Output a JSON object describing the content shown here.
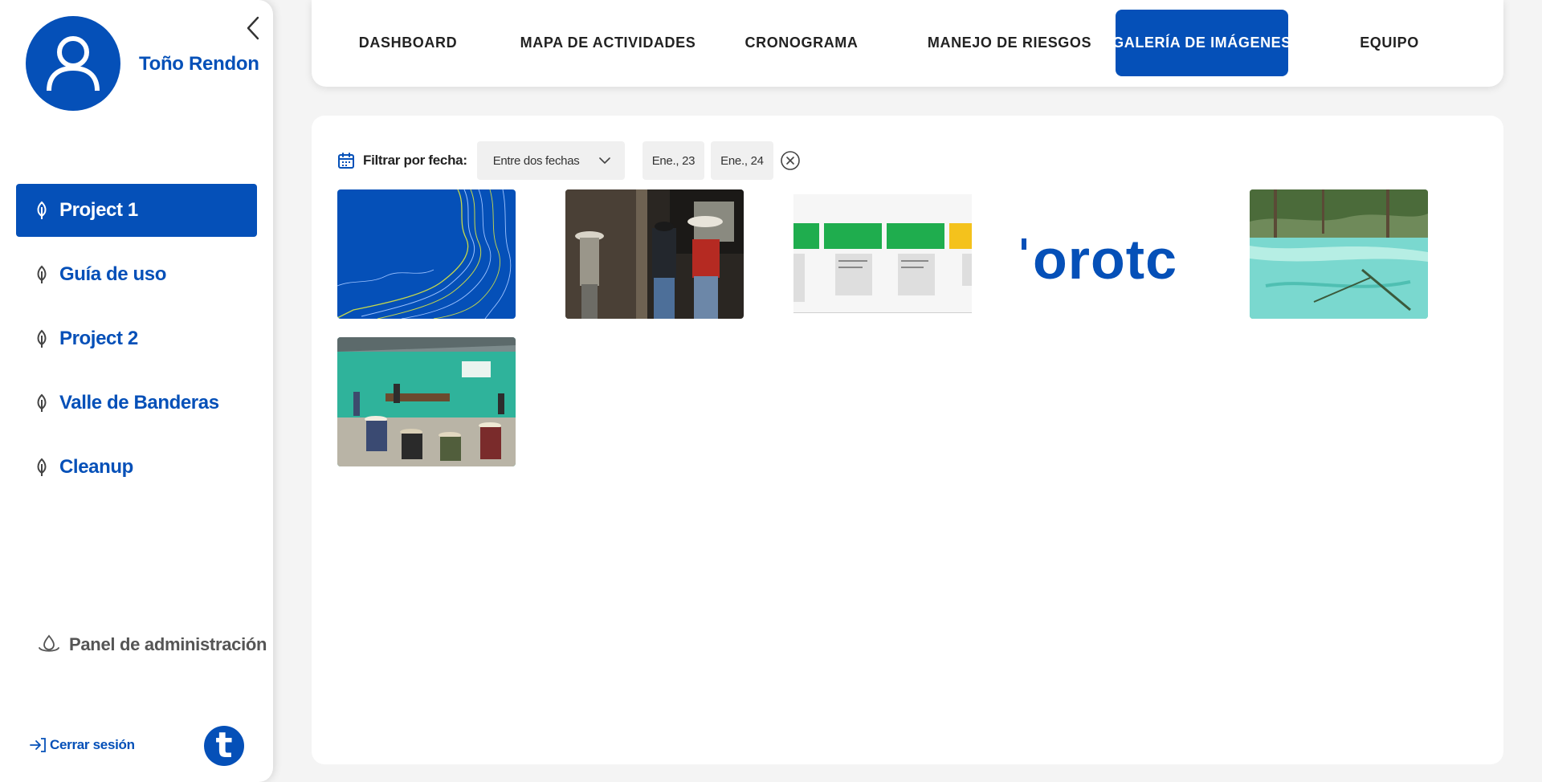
{
  "user": {
    "name": "Toño Rendon"
  },
  "nav": {
    "items": [
      {
        "label": "Project 1",
        "active": true
      },
      {
        "label": "Guía de uso",
        "active": false
      },
      {
        "label": "Project 2",
        "active": false
      },
      {
        "label": "Valle de Banderas",
        "active": false
      },
      {
        "label": "Cleanup",
        "active": false
      }
    ],
    "admin_label": "Panel de administración",
    "logout_label": "Cerrar sesión",
    "logo_letter": "t"
  },
  "tabs": [
    {
      "label": "DASHBOARD",
      "active": false
    },
    {
      "label": "MAPA DE ACTIVIDADES",
      "active": false
    },
    {
      "label": "CRONOGRAMA",
      "active": false
    },
    {
      "label": "MANEJO DE RIESGOS",
      "active": false
    },
    {
      "label": "GALERÍA DE IMÁGENES",
      "active": true
    },
    {
      "label": "EQUIPO",
      "active": false
    }
  ],
  "filter": {
    "label": "Filtrar por fecha:",
    "mode": "Entre dos fechas",
    "start": "Ene., 23",
    "end": "Ene., 24"
  },
  "gallery": {
    "logo_text": "orotc",
    "images": [
      {
        "name": "contour-map"
      },
      {
        "name": "men-in-hats"
      },
      {
        "name": "kanban-board"
      },
      {
        "name": "company-logo"
      },
      {
        "name": "turquoise-river"
      },
      {
        "name": "community-meeting"
      }
    ]
  },
  "colors": {
    "primary": "#0550b8",
    "background": "#f4f4f4",
    "card": "#ffffff",
    "chip": "#f0f0f0"
  }
}
